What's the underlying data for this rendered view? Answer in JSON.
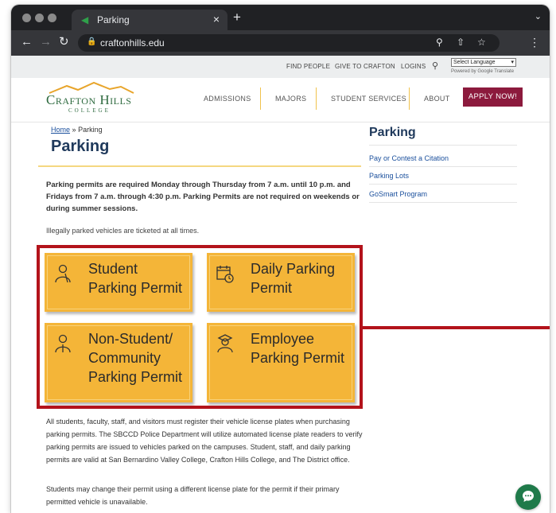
{
  "browser": {
    "tab_title": "Parking",
    "tab_close": "×",
    "new_tab": "+",
    "url": "craftonhills.edu"
  },
  "utility_nav": {
    "links": [
      "FIND PEOPLE",
      "GIVE TO CRAFTON",
      "LOGINS"
    ],
    "language_select": "Select Language",
    "powered_by": "Powered by Google Translate"
  },
  "header": {
    "logo_main": "Crafton Hills",
    "logo_sub": "COLLEGE",
    "nav": [
      "ADMISSIONS",
      "MAJORS",
      "STUDENT SERVICES",
      "ABOUT"
    ],
    "apply_button": "APPLY NOW!"
  },
  "breadcrumb": {
    "home": "Home",
    "separator": "»",
    "current": "Parking"
  },
  "main": {
    "title": "Parking",
    "intro_bold": "Parking permits are required Monday through Thursday from 7 a.m. until 10 p.m. and Fridays from 7 a.m. through 4:30 p.m. Parking Permits are not required on weekends or during summer sessions.",
    "illegal_note": "Illegally parked vehicles are ticketed at all times.",
    "cards": [
      {
        "label_line1": "Student",
        "label_line2": "Parking Permit",
        "label_line3": "",
        "icon": "student-icon"
      },
      {
        "label_line1": "Daily Parking",
        "label_line2": "Permit",
        "label_line3": "",
        "icon": "calendar-clock-icon"
      },
      {
        "label_line1": "Non-Student/",
        "label_line2": "Community",
        "label_line3": "Parking Permit",
        "icon": "person-icon"
      },
      {
        "label_line1": "Employee",
        "label_line2": "Parking Permit",
        "label_line3": "",
        "icon": "graduate-icon"
      }
    ],
    "paragraph1": "All students, faculty, staff, and visitors must register their vehicle license plates when purchasing parking permits. The SBCCD Police Department will utilize automated license plate readers to verify parking permits are issued to vehicles parked on the campuses. Student, staff, and daily parking permits are valid at San Bernardino Valley College, Crafton Hills College, and The District office.",
    "paragraph2": "Students may change their permit using a different license plate for the permit if their primary permitted vehicle is unavailable."
  },
  "sidebar": {
    "title": "Parking",
    "links": [
      "Pay or Contest a Citation",
      "Parking Lots",
      "GoSmart Program"
    ]
  },
  "colors": {
    "card_gold": "#f4b538",
    "highlight_red": "#b3131b",
    "apply_maroon": "#8c1a3d",
    "heading_navy": "#203a5c",
    "link_blue": "#1a4f9c"
  }
}
